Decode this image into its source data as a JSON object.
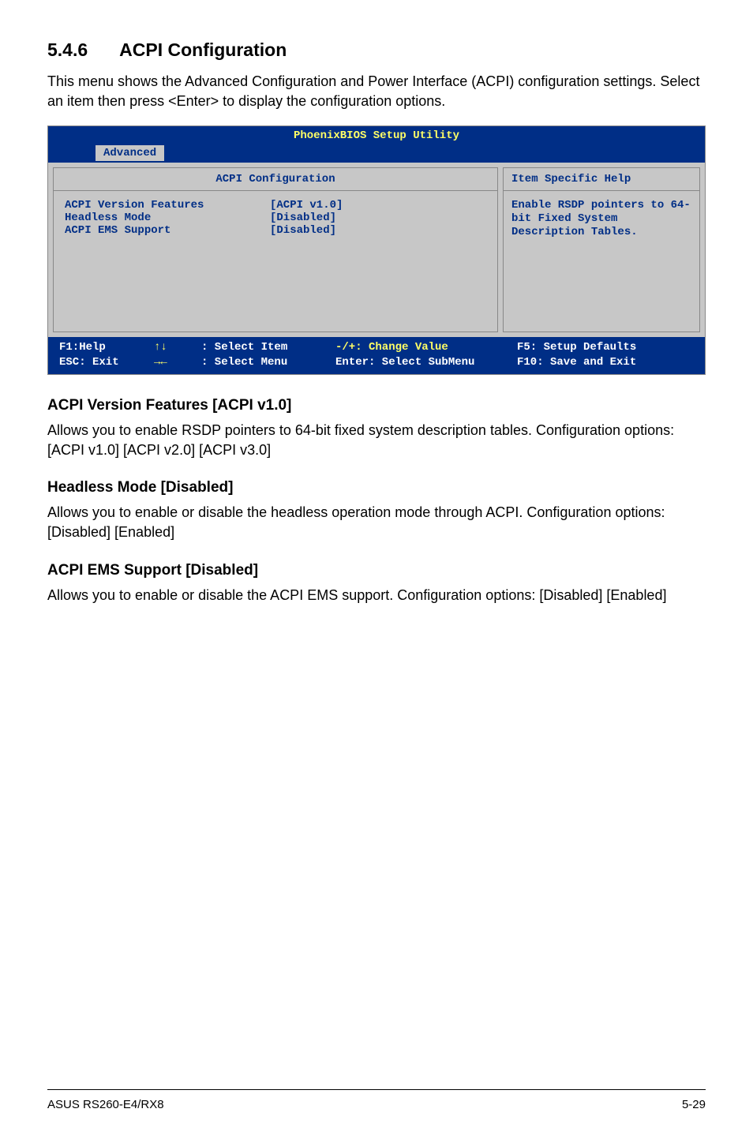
{
  "heading": {
    "number": "5.4.6",
    "title": "ACPI Configuration"
  },
  "intro": "This menu shows the Advanced Configuration and Power Interface (ACPI) configuration settings.  Select an item then press <Enter> to display the configuration options.",
  "bios": {
    "title": "PhoenixBIOS Setup Utility",
    "tab": "Advanced",
    "config_title": "ACPI Configuration",
    "help_title": "Item Specific Help",
    "items": [
      {
        "label": "ACPI Version Features",
        "value": "[ACPI v1.0]"
      },
      {
        "label": "Headless Mode",
        "value": "[Disabled]"
      },
      {
        "label": "ACPI EMS Support",
        "value": "[Disabled]"
      }
    ],
    "help_text": "Enable RSDP pointers to 64-bit Fixed System Description Tables.",
    "footer": {
      "f1": "F1:Help",
      "esc": "ESC: Exit",
      "updown": "↑↓",
      "leftright": "→←",
      "select_item": ": Select Item",
      "select_menu": ": Select Menu",
      "change_value": "-/+: Change Value",
      "select_submenu": "Enter: Select SubMenu",
      "f5": "F5: Setup Defaults",
      "f10": "F10: Save and Exit"
    }
  },
  "sections": [
    {
      "heading": "ACPI Version Features [ACPI v1.0]",
      "text": "Allows you to enable RSDP pointers to 64-bit fixed system description tables. Configuration options: [ACPI v1.0] [ACPI v2.0] [ACPI v3.0]"
    },
    {
      "heading": "Headless Mode [Disabled]",
      "text": "Allows you to enable or disable the headless operation mode through ACPI. Configuration options: [Disabled] [Enabled]"
    },
    {
      "heading": "ACPI EMS Support [Disabled]",
      "text": "Allows you to enable or disable the ACPI EMS support. Configuration options: [Disabled] [Enabled]"
    }
  ],
  "footer": {
    "left": "ASUS RS260-E4/RX8",
    "right": "5-29"
  }
}
